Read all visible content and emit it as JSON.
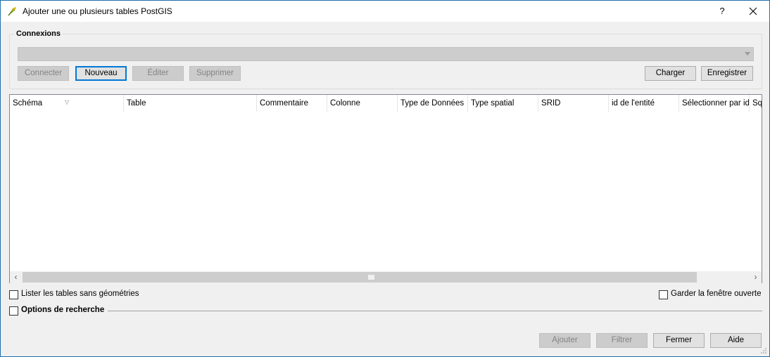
{
  "window": {
    "title": "Ajouter une ou plusieurs tables PostGIS",
    "help_label": "?"
  },
  "connections": {
    "group_title": "Connexions",
    "selected": "",
    "buttons": {
      "connect": "Connecter",
      "new": "Nouveau",
      "edit": "Éditer",
      "delete": "Supprimer",
      "load": "Charger",
      "save": "Enregistrer"
    }
  },
  "table": {
    "columns": [
      "Schéma",
      "Table",
      "Commentaire",
      "Colonne",
      "Type de Données",
      "Type spatial",
      "SRID",
      "id de l'entité",
      "Sélectionner par ide",
      "Sql"
    ],
    "rows": []
  },
  "options": {
    "list_tables_no_geometry": "Lister les tables sans géométries",
    "keep_window_open": "Garder la fenêtre ouverte",
    "search_options": "Options de recherche"
  },
  "footer": {
    "add": "Ajouter",
    "filter": "Filtrer",
    "close": "Fermer",
    "help": "Aide"
  },
  "colors": {
    "accent": "#0078d7",
    "window_border": "#1e6fb0",
    "disabled_bg": "#cccccc"
  }
}
